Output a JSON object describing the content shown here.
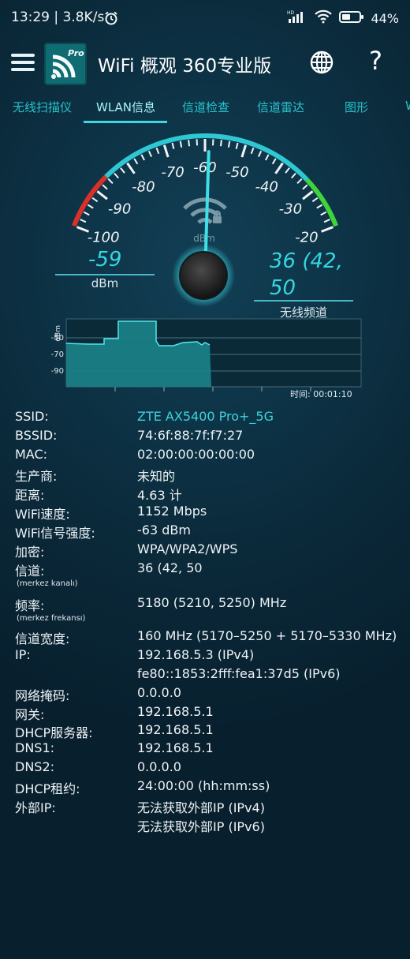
{
  "status": {
    "time": "13:29 | 3.8K/s",
    "network": "HD",
    "battery": "44%"
  },
  "app": {
    "title": "WiFi 概观 360专业版",
    "logo_badge": "Pro"
  },
  "tabs": [
    "无线扫描仪",
    "WLAN信息",
    "信道检查",
    "信道雷达",
    "图形",
    "W"
  ],
  "gauge": {
    "ticks": [
      "-100",
      "-90",
      "-80",
      "-70",
      "-60",
      "-50",
      "-40",
      "-30",
      "-20"
    ],
    "center_unit": "dBm",
    "needle_value_dbm": -59,
    "signal_value": "-59",
    "signal_unit": "dBm",
    "channel_value": "36 (42, 50",
    "channel_label": "无线频道"
  },
  "graph": {
    "y_axis_label": "dBm",
    "y_ticks": [
      "-50",
      "-70",
      "-90"
    ],
    "time_label": "时间:  00:01:10"
  },
  "colors": {
    "accent": "#2fc8d2",
    "background": "#0b2a3a",
    "gauge_red": "#d9302a",
    "gauge_green": "#3fd43a"
  },
  "info": {
    "ssid_label": "SSID:",
    "ssid": "ZTE AX5400 Pro+_5G",
    "bssid_label": "BSSID:",
    "bssid": "74:6f:88:7f:f7:27",
    "mac_label": "MAC:",
    "mac": "02:00:00:00:00:00",
    "vendor_label": "生产商:",
    "vendor": "未知的",
    "distance_label": "距离:",
    "distance": "4.63 计",
    "speed_label": "WiFi速度:",
    "speed": "1152 Mbps",
    "strength_label": "WiFi信号强度:",
    "strength": "-63 dBm",
    "encryption_label": "加密:",
    "encryption": "WPA/WPA2/WPS",
    "channel_label": "信道:",
    "channel": "36 (42, 50",
    "channel_sub": "(merkez kanalı)",
    "frequency_label": "频率:",
    "frequency": "5180 (5210, 5250) MHz",
    "frequency_sub": "(merkez frekansı)",
    "width_label": "信道宽度:",
    "width": "160 MHz (5170–5250 + 5170–5330 MHz)",
    "ip_label": "IP:",
    "ipv4": "192.168.5.3 (IPv4)",
    "ipv6": "fe80::1853:2fff:fea1:37d5 (IPv6)",
    "netmask_label": "网络掩码:",
    "netmask": "0.0.0.0",
    "gateway_label": "网关:",
    "gateway": "192.168.5.1",
    "dhcp_label": "DHCP服务器:",
    "dhcp": "192.168.5.1",
    "dns1_label": "DNS1:",
    "dns1": "192.168.5.1",
    "dns2_label": "DNS2:",
    "dns2": "0.0.0.0",
    "lease_label": "DHCP租约:",
    "lease": "24:00:00 (hh:mm:ss)",
    "extip_label": "外部IP:",
    "extip4": "无法获取外部IP (IPv4)",
    "extip6": "无法获取外部IP (IPv6)"
  }
}
